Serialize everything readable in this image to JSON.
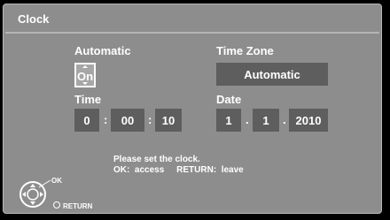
{
  "title": "Clock",
  "automatic": {
    "label": "Automatic",
    "value": "On"
  },
  "timezone": {
    "label": "Time Zone",
    "value": "Automatic"
  },
  "time": {
    "label": "Time",
    "hour": "0",
    "minute": "00",
    "second": "10",
    "separator": ":"
  },
  "date": {
    "label": "Date",
    "day": "1",
    "month": "1",
    "year": "2010",
    "separator": "."
  },
  "message": {
    "line1": "Please set the clock.",
    "line2": "OK:  access     RETURN:  leave"
  },
  "remote": {
    "ok_label": "OK",
    "return_label": "RETURN"
  },
  "colors": {
    "panel": "#8d8d8d",
    "field": "#5e5e5e",
    "text": "#ffffff"
  }
}
